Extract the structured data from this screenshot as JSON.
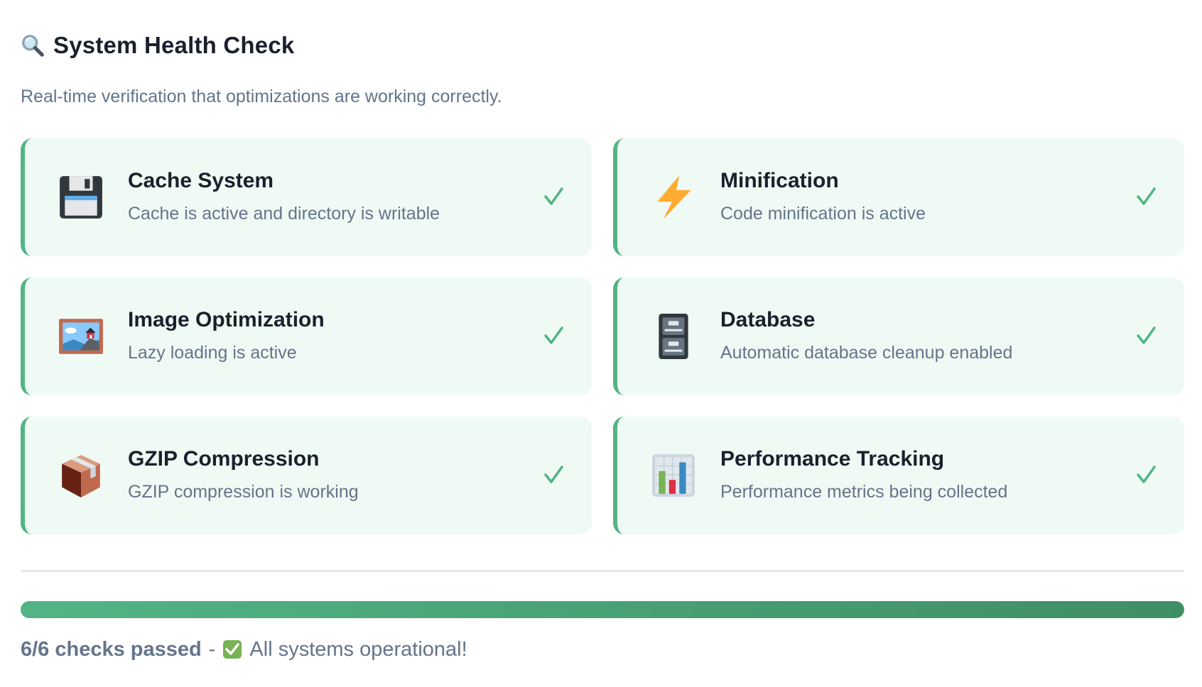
{
  "header": {
    "icon": "magnifying-glass-icon",
    "title": "System Health Check",
    "description": "Real-time verification that optimizations are working correctly."
  },
  "checks": [
    {
      "title": "Cache System",
      "message": "Cache is active and directory is writable",
      "icon": "floppy-disk-icon",
      "status": "passed"
    },
    {
      "title": "Minification",
      "message": "Code minification is active",
      "icon": "lightning-bolt-icon",
      "status": "passed"
    },
    {
      "title": "Image Optimization",
      "message": "Lazy loading is active",
      "icon": "framed-picture-icon",
      "status": "passed"
    },
    {
      "title": "Database",
      "message": "Automatic database cleanup enabled",
      "icon": "file-cabinet-icon",
      "status": "passed"
    },
    {
      "title": "GZIP Compression",
      "message": "GZIP compression is working",
      "icon": "package-box-icon",
      "status": "passed"
    },
    {
      "title": "Performance Tracking",
      "message": "Performance metrics being collected",
      "icon": "bar-chart-icon",
      "status": "passed"
    }
  ],
  "progress": {
    "passed": 6,
    "total": 6,
    "fraction": 1.0
  },
  "summary": {
    "count_text": "6/6 checks passed",
    "separator": "-",
    "status_icon": "check-mark-button-icon",
    "status_text": "All systems operational!"
  },
  "colors": {
    "accent": "#52b484",
    "accent_dark": "#3f8f64",
    "card_background": "#f0faf4",
    "muted_text": "#64748b",
    "heading_text": "#1a202c"
  }
}
